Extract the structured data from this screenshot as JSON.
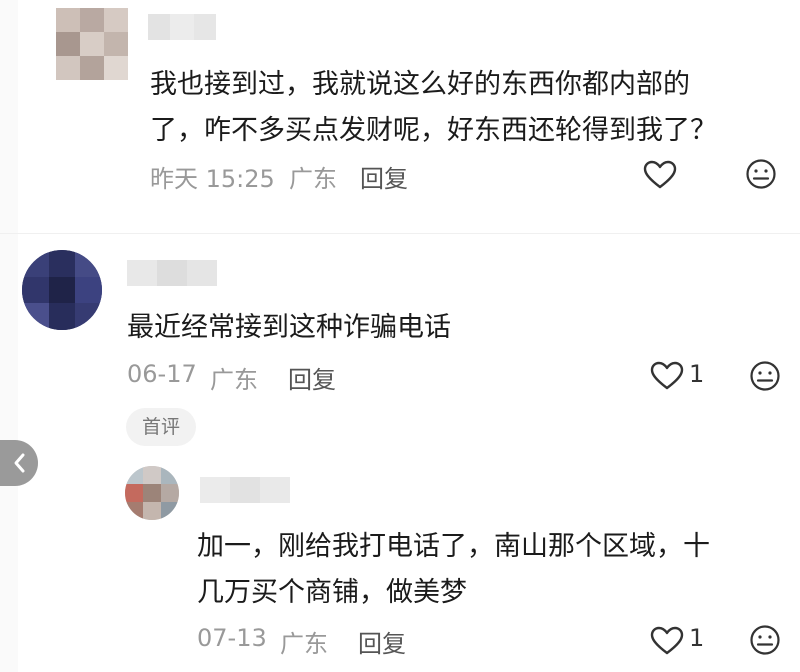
{
  "comments": [
    {
      "text_lines": [
        "我也接到过，我就说这么好的东西你都内部的",
        "了，咋不多买点发财呢，好东西还轮得到我了？"
      ],
      "time": "昨天 15:25",
      "location": "广东",
      "reply_label": "回复",
      "like_count": "",
      "icons": {
        "like": "heart-outline-icon",
        "react": "neutral-face-icon"
      }
    },
    {
      "text_lines": [
        "最近经常接到这种诈骗电话"
      ],
      "time": "06-17",
      "location": "广东",
      "reply_label": "回复",
      "like_count": "1",
      "badge": "首评",
      "icons": {
        "like": "heart-outline-icon",
        "react": "neutral-face-icon"
      }
    },
    {
      "text_lines": [
        "加一，刚给我打电话了，南山那个区域，十",
        "几万买个商铺，做美梦"
      ],
      "time": "07-13",
      "location": "广东",
      "reply_label": "回复",
      "like_count": "1",
      "icons": {
        "like": "heart-outline-icon",
        "react": "neutral-face-icon"
      }
    }
  ],
  "nav": {
    "back_icon": "chevron-left-icon"
  }
}
